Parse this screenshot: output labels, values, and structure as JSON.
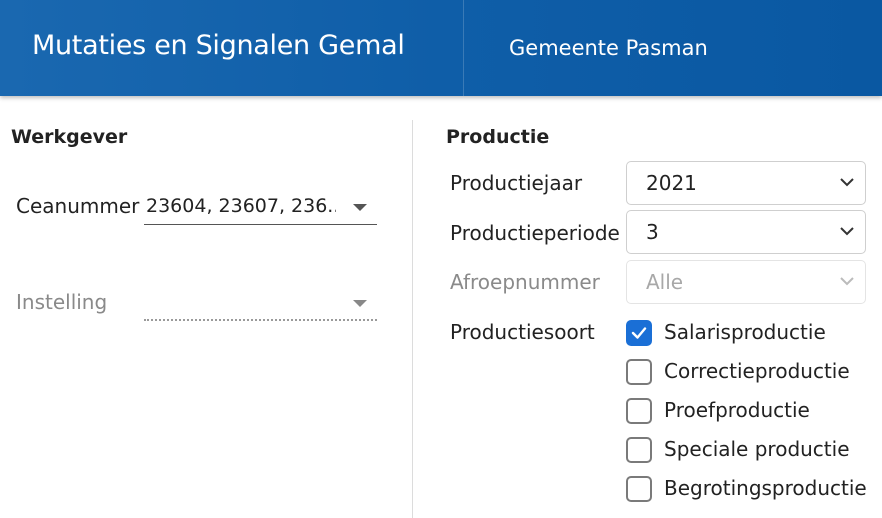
{
  "header": {
    "app_title": "Mutaties en Signalen Gemal",
    "org_name": "Gemeente Pasman"
  },
  "werkgever": {
    "title": "Werkgever",
    "ceanummer": {
      "label": "Ceanummer",
      "value": "23604, 23607, 236..."
    },
    "instelling": {
      "label": "Instelling",
      "value": ""
    }
  },
  "productie": {
    "title": "Productie",
    "productiejaar": {
      "label": "Productiejaar",
      "value": "2021"
    },
    "productieperiode": {
      "label": "Productieperiode",
      "value": "3"
    },
    "afroepnummer": {
      "label": "Afroepnummer",
      "value": "Alle"
    },
    "productiesoort": {
      "label": "Productiesoort",
      "options": [
        {
          "label": "Salarisproductie",
          "checked": true
        },
        {
          "label": "Correctieproductie",
          "checked": false
        },
        {
          "label": "Proefproductie",
          "checked": false
        },
        {
          "label": "Speciale productie",
          "checked": false
        },
        {
          "label": "Begrotingsproductie",
          "checked": false
        }
      ]
    }
  },
  "colors": {
    "header_bg": "#0f5ea8",
    "checkbox_checked": "#1a6fd6"
  }
}
